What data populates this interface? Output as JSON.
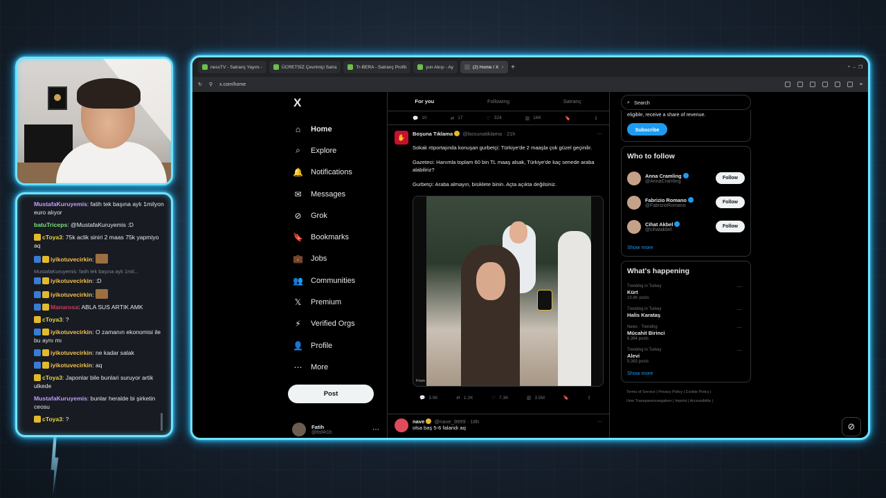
{
  "chat": {
    "messages": [
      {
        "user": "MustafaKuruyemis",
        "color": "#c39bff",
        "badges": [],
        "text": "fatih tek başına aylı 1milyon euro alıyor"
      },
      {
        "user": "batuTriceps",
        "color": "#7de07d",
        "badges": [],
        "text": "@MustafaKuruyemis :D"
      },
      {
        "user": "cToya3",
        "color": "#e2d640",
        "badges": [
          "gold"
        ],
        "text": "75k aclik siniri 2 maas 75k yapmiyo aq"
      },
      {
        "user": "iyikotuvecirkin",
        "color": "#f2c14e",
        "badges": [
          "blue",
          "gold"
        ],
        "text": "",
        "emote": true
      },
      {
        "reply": "MustafaKuruyemis: fatih tek başına aylı 1mil..."
      },
      {
        "user": "iyikotuvecirkin",
        "color": "#f2c14e",
        "badges": [
          "blue",
          "gold"
        ],
        "text": ":D"
      },
      {
        "user": "iyikotuvecirkin",
        "color": "#f2c14e",
        "badges": [
          "blue",
          "gold"
        ],
        "text": "",
        "emote": true
      },
      {
        "user": "Manarosa",
        "color": "#d03a5a",
        "badges": [
          "blue",
          "gold"
        ],
        "text": "ABLA SUS ARTIK AMK"
      },
      {
        "user": "cToya3",
        "color": "#e2d640",
        "badges": [
          "gold"
        ],
        "text": "?"
      },
      {
        "user": "iyikotuvecirkin",
        "color": "#f2c14e",
        "badges": [
          "blue",
          "gold"
        ],
        "text": "O zamanın ekonomisi ile bu aynı mı"
      },
      {
        "user": "iyikotuvecirkin",
        "color": "#f2c14e",
        "badges": [
          "blue",
          "gold"
        ],
        "text": "ne kadar salak"
      },
      {
        "user": "iyikotuvecirkin",
        "color": "#f2c14e",
        "badges": [
          "blue",
          "gold"
        ],
        "text": "aq"
      },
      {
        "user": "cToya3",
        "color": "#e2d640",
        "badges": [
          "gold"
        ],
        "text": "Japonlar bile bunlari suruyor artik ulkede"
      },
      {
        "user": "MustafaKuruyemis",
        "color": "#c39bff",
        "badges": [],
        "text": "bunlar heralde bi şirketin ceosu"
      },
      {
        "user": "cToya3",
        "color": "#e2d640",
        "badges": [
          "gold"
        ],
        "text": "?"
      }
    ]
  },
  "browser": {
    "tabs": [
      {
        "label": "nessTV - Satranç Yayını -",
        "active": false
      },
      {
        "label": "ÜCRETSİZ Çevrimiçi Satra",
        "active": false
      },
      {
        "label": "Tr-BERA - Satranç Profili",
        "active": false
      },
      {
        "label": "yun Akışı - Ay",
        "active": false
      },
      {
        "label": "(2) Home / X",
        "active": true
      }
    ],
    "url": "x.com/home"
  },
  "nav": {
    "logo": "X",
    "items": [
      {
        "label": "Home",
        "icon": "home-icon",
        "glyph": "⌂",
        "bold": true
      },
      {
        "label": "Explore",
        "icon": "search-icon",
        "glyph": "⌕",
        "bold": false
      },
      {
        "label": "Notifications",
        "icon": "bell-icon",
        "glyph": "🔔",
        "bold": false
      },
      {
        "label": "Messages",
        "icon": "mail-icon",
        "glyph": "✉",
        "bold": false
      },
      {
        "label": "Grok",
        "icon": "grok-icon",
        "glyph": "⊘",
        "bold": false
      },
      {
        "label": "Bookmarks",
        "icon": "bookmark-icon",
        "glyph": "🔖",
        "bold": false
      },
      {
        "label": "Jobs",
        "icon": "briefcase-icon",
        "glyph": "💼",
        "bold": false
      },
      {
        "label": "Communities",
        "icon": "people-icon",
        "glyph": "👥",
        "bold": false
      },
      {
        "label": "Premium",
        "icon": "x-premium-icon",
        "glyph": "𝕏",
        "bold": false
      },
      {
        "label": "Verified Orgs",
        "icon": "lightning-icon",
        "glyph": "⚡",
        "bold": false
      },
      {
        "label": "Profile",
        "icon": "user-icon",
        "glyph": "👤",
        "bold": false
      },
      {
        "label": "More",
        "icon": "more-circle-icon",
        "glyph": "⋯",
        "bold": false
      }
    ],
    "post_label": "Post",
    "profile": {
      "name": "Fatih",
      "handle": "@ltsf4t1h"
    }
  },
  "feed": {
    "tabs": [
      "For you",
      "Following",
      "Satranç"
    ],
    "prev_actions": {
      "replies": "10",
      "reposts": "17",
      "likes": "324",
      "views": "16K"
    },
    "tweet": {
      "name": "Boşuna Tıklama",
      "handle": "@bosunatiklama",
      "time": "21h",
      "lines": [
        "Sokak röportajında konuşan gurbetçi: Türkiye'de 2 maaşla çok güzel geçinilir.",
        "Gazeteci: Hanımla toplam 60 bin TL maaş alsak, Türkiye'de kaç senede araba alabiliriz?",
        "Gurbetçi: Araba almayın, bisiklete binin. Açta açıkta değilsiniz."
      ],
      "media_caption": "From",
      "actions": {
        "replies": "3.9K",
        "reposts": "1.2K",
        "likes": "7.3K",
        "views": "3.5M"
      }
    },
    "next_tweet": {
      "name": "nave",
      "handle": "@nave_9999",
      "time": "18h",
      "text": "olsa baş 5-6 falandı aq"
    }
  },
  "sidebar": {
    "search_placeholder": "Search",
    "premium_text": "eligible, receive a share of revenue.",
    "subscribe_label": "Subscribe",
    "who_to_follow_title": "Who to follow",
    "follow_label": "Follow",
    "suggestions": [
      {
        "name": "Anna Cramling",
        "handle": "@AnnaCramling"
      },
      {
        "name": "Fabrizio Romano",
        "handle": "@FabrizioRomano"
      },
      {
        "name": "Cihat Akbel",
        "handle": "@cihatakbel"
      }
    ],
    "show_more": "Show more",
    "happening_title": "What's happening",
    "trends": [
      {
        "context": "Trending in Turkey",
        "title": "Kürt",
        "count": "19.8K posts"
      },
      {
        "context": "Trending in Turkey",
        "title": "Halis Karataş",
        "count": ""
      },
      {
        "context": "News · Trending",
        "title": "Mücahit Birinci",
        "count": "6,364 posts"
      },
      {
        "context": "Trending in Turkey",
        "title": "Alevi",
        "count": "5,383 posts"
      }
    ],
    "footer": [
      "Terms of Service",
      "Privacy Policy",
      "Cookie Policy",
      "Imprint",
      "Accessibility"
    ],
    "footer_row2_first": "Unw Transparenzangaben"
  },
  "colors": {
    "accent": "#1d9bf0",
    "neon": "#6fe3ff"
  }
}
